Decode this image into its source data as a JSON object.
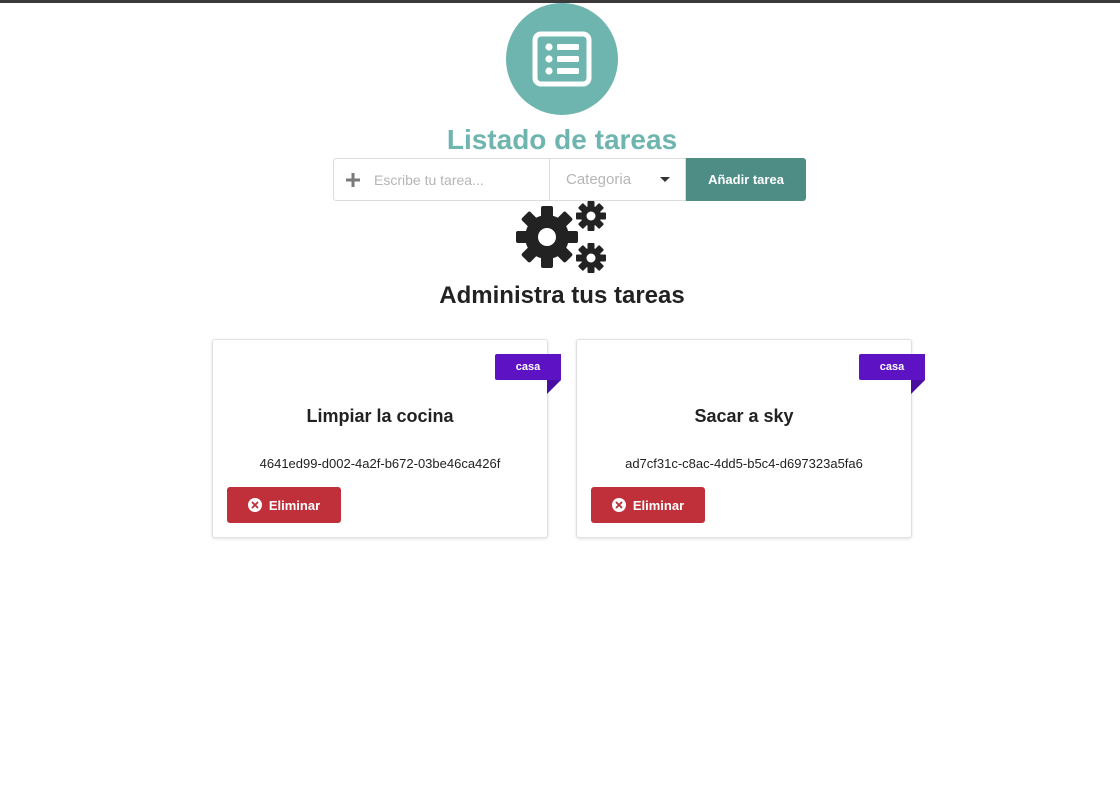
{
  "header": {
    "icon": "list-icon",
    "title": "Listado de tareas"
  },
  "form": {
    "task_placeholder": "Escribe tu tarea...",
    "task_value": "",
    "category_selected": "Categoria",
    "add_label": "Añadir tarea",
    "plus_icon": "plus-icon"
  },
  "section": {
    "icon": "gears-icon",
    "title": "Administra tus tareas"
  },
  "tasks": [
    {
      "title": "Limpiar la cocina",
      "id": "4641ed99-d002-4a2f-b672-03be46ca426f",
      "category": "casa",
      "delete_label": "Eliminar"
    },
    {
      "title": "Sacar a sky",
      "id": "ad7cf31c-c8ac-4dd5-b5c4-d697323a5fa6",
      "category": "casa",
      "delete_label": "Eliminar"
    }
  ],
  "colors": {
    "accent": "#6db5ae",
    "button_primary": "#4e8c86",
    "danger": "#c0303a",
    "category_badge": "#5d12c4"
  }
}
